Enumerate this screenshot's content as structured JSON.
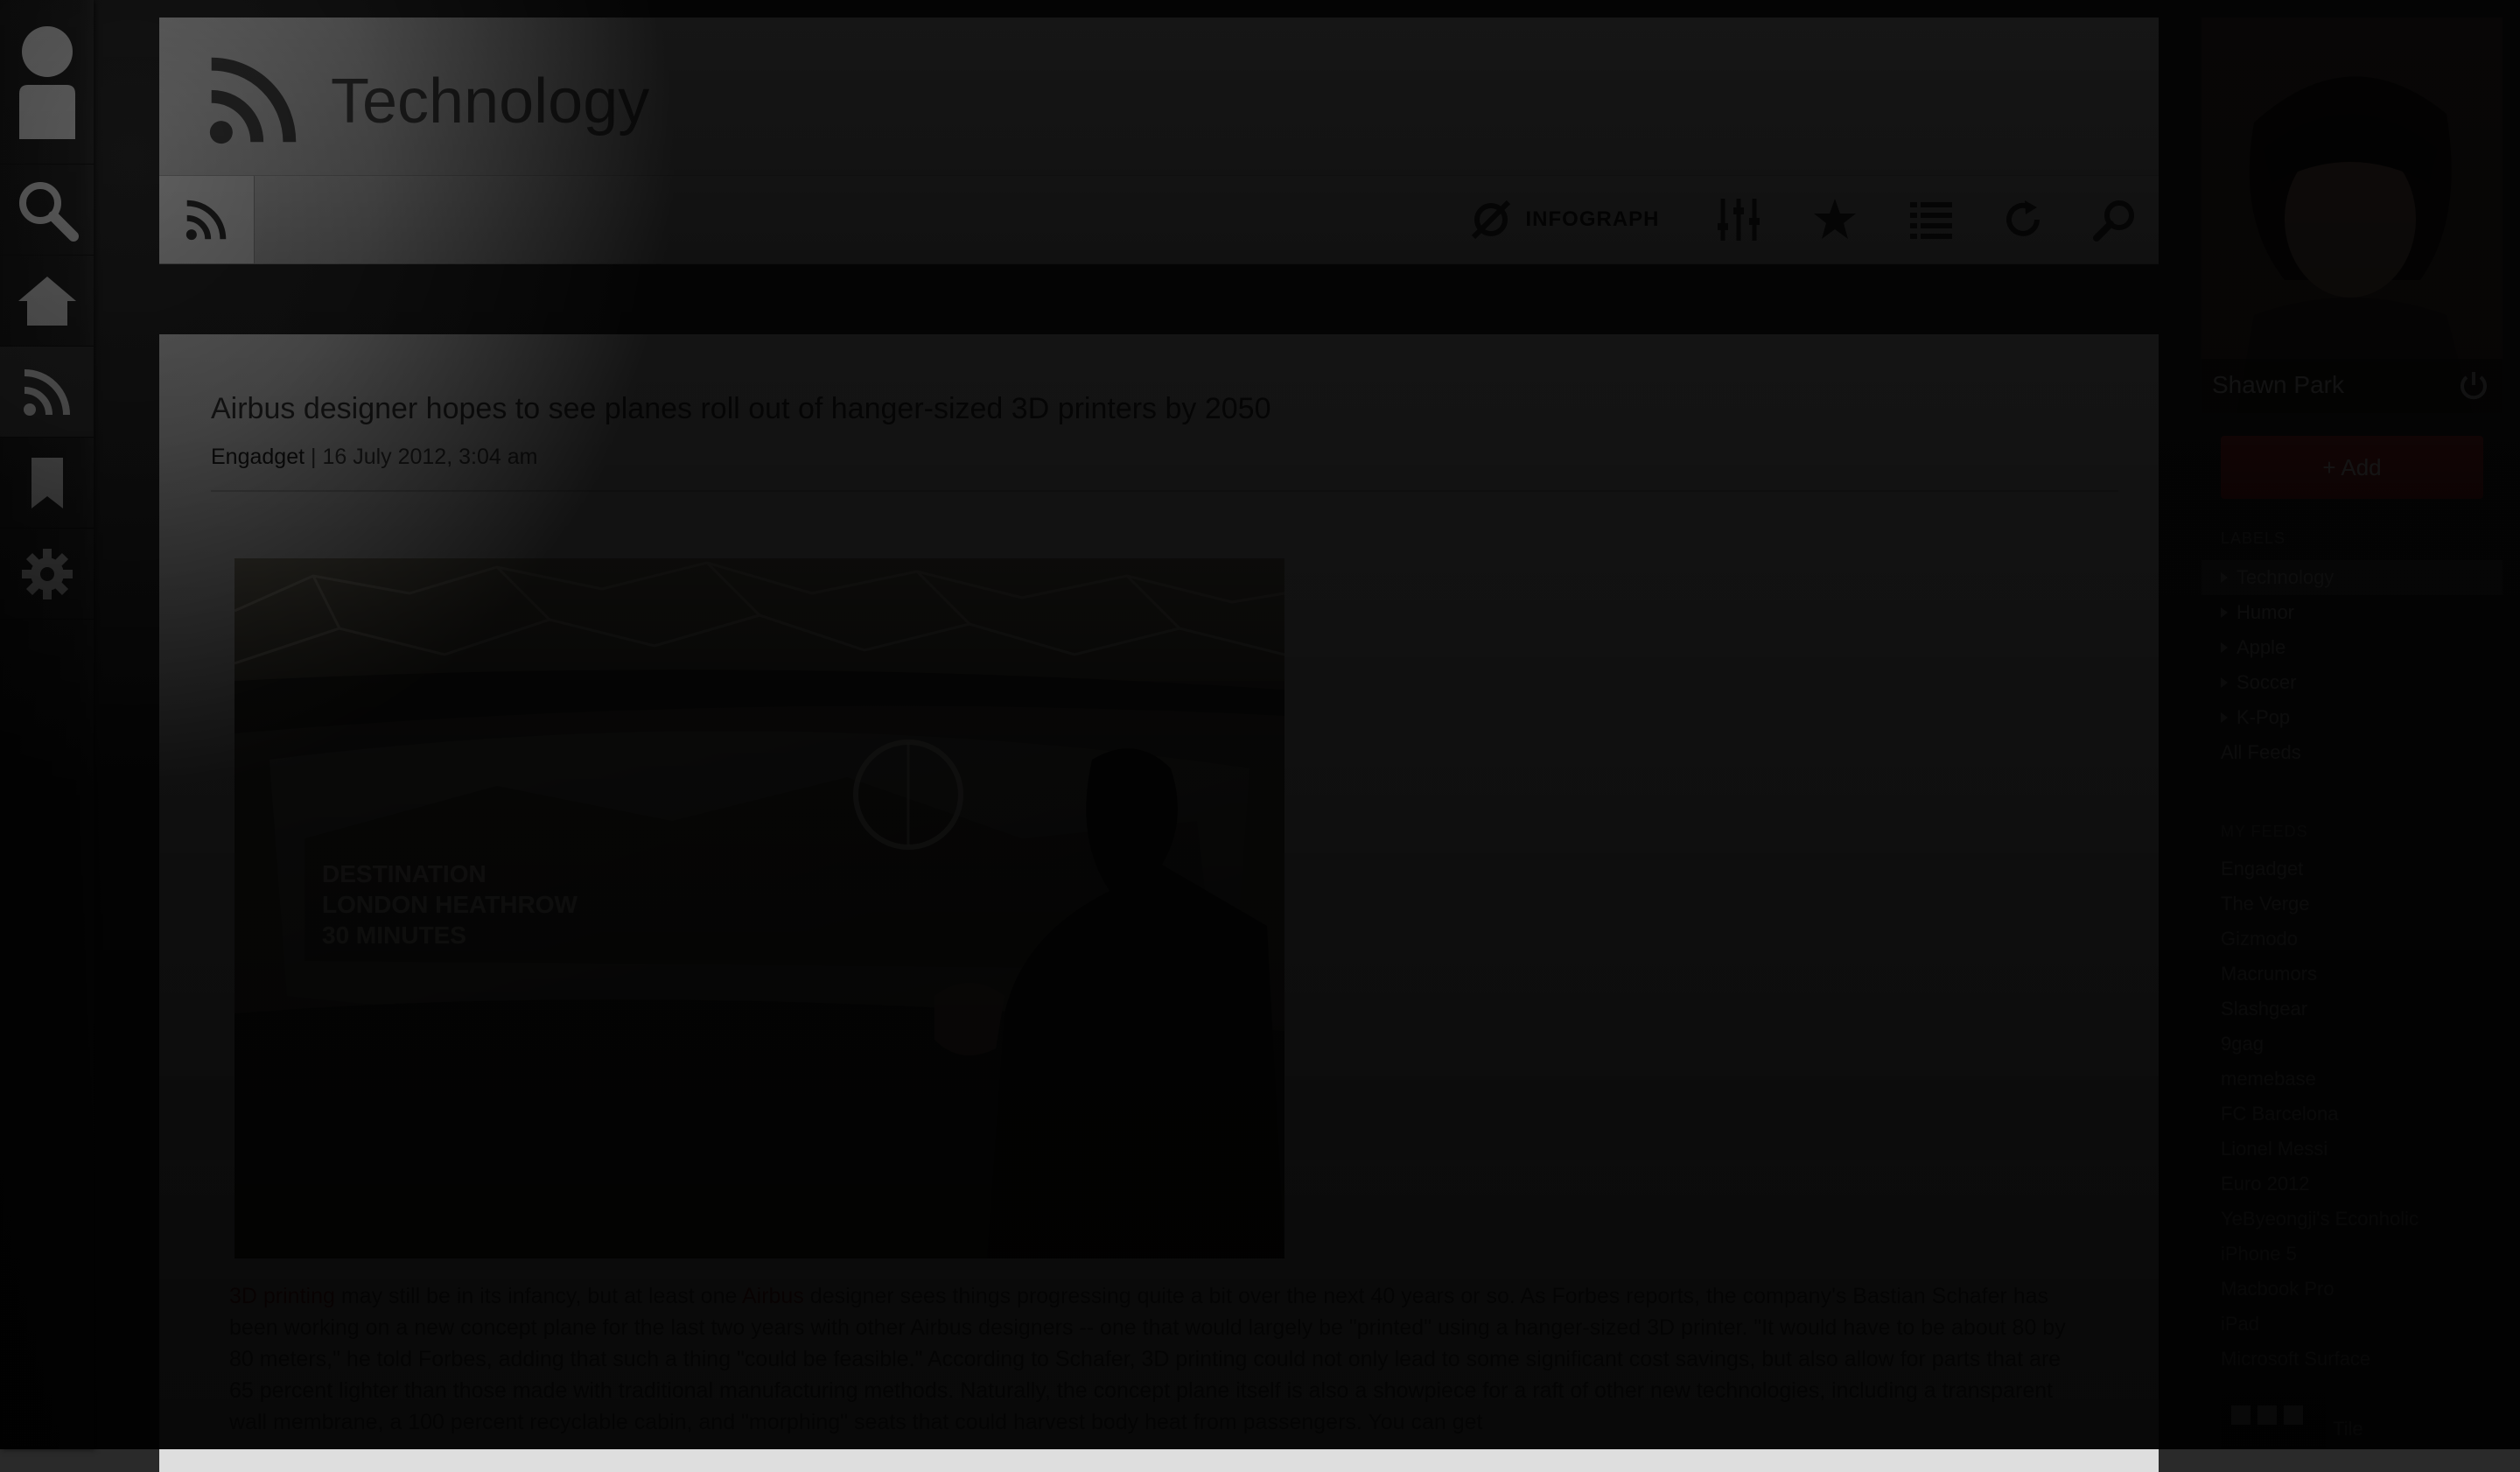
{
  "leftnav": {
    "items": [
      {
        "icon": "avatar-icon",
        "label": "Profile"
      },
      {
        "icon": "search-icon",
        "label": "Search"
      },
      {
        "icon": "home-icon",
        "label": "Home"
      },
      {
        "icon": "rss-icon",
        "label": "Feeds",
        "active": true
      },
      {
        "icon": "bookmark-icon",
        "label": "Bookmarks"
      },
      {
        "icon": "gear-icon",
        "label": "Settings"
      }
    ]
  },
  "header": {
    "icon": "rss-icon",
    "title": "Technology"
  },
  "toolbar": {
    "infograph_label": "INFOGRAPH",
    "buttons": [
      "infograph-icon",
      "sliders-icon",
      "star-icon",
      "list-icon",
      "refresh-icon",
      "search-icon"
    ]
  },
  "article": {
    "title": "Airbus designer hopes to see planes roll out of hanger-sized 3D printers by 2050",
    "source": "Engadget",
    "date": "16 July 2012, 3:04 am",
    "image_overlay": {
      "line1": "DESTINATION",
      "line2": "LONDON HEATHROW",
      "line3": "30 MINUTES"
    },
    "body_link1": "3D printing",
    "body_part1": " may still be in its infancy, but at least one ",
    "body_link2": "Airbus",
    "body_part2": " designer sees things progressing quite a bit over the next 40 years or so. As Forbes reports, the company's Bastian Schafer has been working on a new concept plane for the last two years with other Airbus designers -- one that would largely be \"printed\" using a hanger-sized 3D printer. \"It would have to be about 80 by 80 meters,\" he told Forbes, adding that such a thing \"could be feasible.\" According to Schafer, 3D printing could not only lead to some significant cost savings, but also allow for parts that are 65 percent lighter than those made with traditional manufacturing methods. Naturally, the concept plane itself is also a showpiece for a raft of other new technologies, including a transparent wall membrane, a 100 percent recyclable cabin, and \"morphing\" seats that could harvest body heat from passengers. You can get"
  },
  "sidebar": {
    "profile_name": "Shawn Park",
    "add_label": "+ Add",
    "labels_heading": "LABELS",
    "labels": [
      "Technology",
      "Humor",
      "Apple",
      "Soccer",
      "K-Pop"
    ],
    "all_feeds": "All Feeds",
    "my_feeds_heading": "MY FEEDS",
    "feeds": [
      "Engadget",
      "The Verge",
      "Gizmodo",
      "Macrumors",
      "Slashgear",
      "9gag",
      "memebase",
      "FC Barcelona",
      "Lionel Messi",
      "Euro 2012",
      "YeByeongji's Econholic",
      "iPhone 5",
      "Macbook Pro",
      "iPad",
      "Microsoft Surface"
    ],
    "footer_label": "Tile"
  },
  "colors": {
    "accent": "#c0302f",
    "nav_bg": "#222222",
    "header_bg": "#d8d8d8"
  }
}
